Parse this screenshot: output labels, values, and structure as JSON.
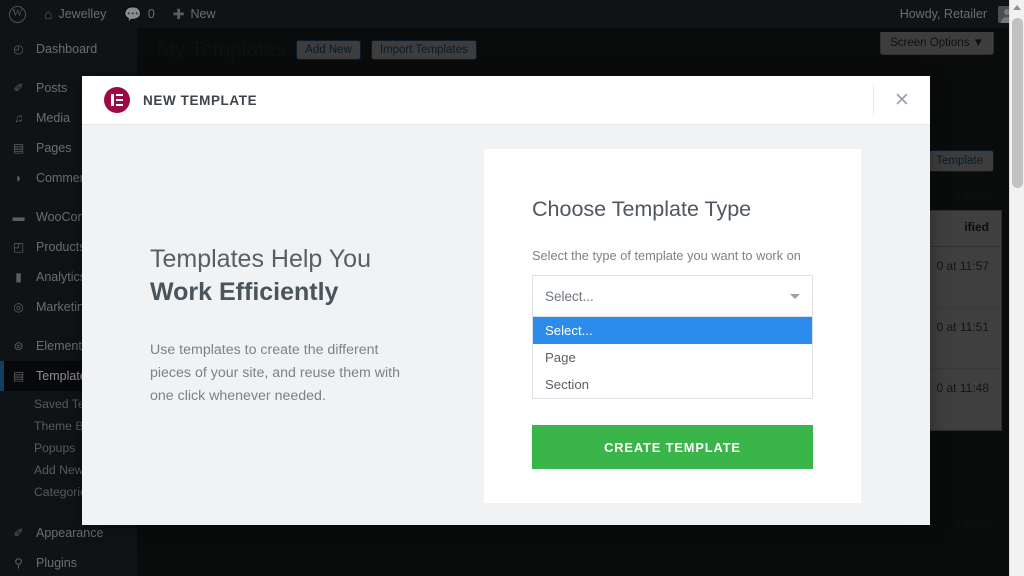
{
  "adminbar": {
    "wp_logo": "wordpress-logo",
    "site_name": "Jewelley",
    "comment_count": "0",
    "new_label": "New",
    "greeting": "Howdy, Retailer"
  },
  "sidebar": {
    "items": [
      {
        "label": "Dashboard",
        "icon": "dashboard-icon",
        "glyph": "◔"
      },
      {
        "label": "Posts",
        "icon": "pin-icon",
        "glyph": "✎"
      },
      {
        "label": "Media",
        "icon": "media-icon",
        "glyph": "♬"
      },
      {
        "label": "Pages",
        "icon": "page-icon",
        "glyph": "▤"
      },
      {
        "label": "Comments",
        "icon": "comment-icon",
        "glyph": "◗"
      },
      {
        "label": "WooCommerce",
        "icon": "woocommerce-icon",
        "glyph": "▬"
      },
      {
        "label": "Products",
        "icon": "products-icon",
        "glyph": "◫"
      },
      {
        "label": "Analytics",
        "icon": "analytics-icon",
        "glyph": "▮"
      },
      {
        "label": "Marketing",
        "icon": "marketing-icon",
        "glyph": "◎"
      },
      {
        "label": "Elementor",
        "icon": "elementor-icon",
        "glyph": "⊞"
      },
      {
        "label": "Templates",
        "icon": "templates-icon",
        "glyph": "▤"
      }
    ],
    "submenu": [
      {
        "label": "Saved Templates"
      },
      {
        "label": "Theme Builder"
      },
      {
        "label": "Popups"
      },
      {
        "label": "Add New"
      },
      {
        "label": "Categories"
      }
    ],
    "bottom_items": [
      {
        "label": "Appearance",
        "icon": "appearance-icon",
        "glyph": "✎"
      },
      {
        "label": "Plugins",
        "icon": "plugins-icon",
        "glyph": "⚲"
      }
    ]
  },
  "page": {
    "title": "My Templates",
    "add_new_label": "Add New",
    "import_label": "Import Templates",
    "screen_options_label": "Screen Options",
    "screen_options_caret": "▼",
    "bg_button_label": "Template",
    "items_count_top": "3 items",
    "items_count_bottom": "3 items",
    "table_header": "ified",
    "table_rows": [
      {
        "date": "0 at 11:57"
      },
      {
        "date": "0 at 11:51"
      },
      {
        "date": "0 at 11:48"
      }
    ]
  },
  "modal": {
    "logo_name": "elementor-logo",
    "title": "NEW TEMPLATE",
    "close_label": "✕",
    "left": {
      "heading_line1": "Templates Help You",
      "heading_line2": "Work Efficiently",
      "body": "Use templates to create the different pieces of your site, and reuse them with one click whenever needed."
    },
    "right": {
      "card_title": "Choose Template Type",
      "field_label": "Select the type of template you want to work on",
      "select_value": "Select...",
      "options": [
        {
          "label": "Select...",
          "selected": true
        },
        {
          "label": "Page",
          "selected": false
        },
        {
          "label": "Section",
          "selected": false
        }
      ],
      "create_button": "CREATE TEMPLATE"
    }
  },
  "colors": {
    "elementor_crimson": "#9b0a46",
    "option_highlight_blue": "#2b8ceb",
    "create_button_green": "#39b54a",
    "admin_dark": "#1d2327"
  }
}
